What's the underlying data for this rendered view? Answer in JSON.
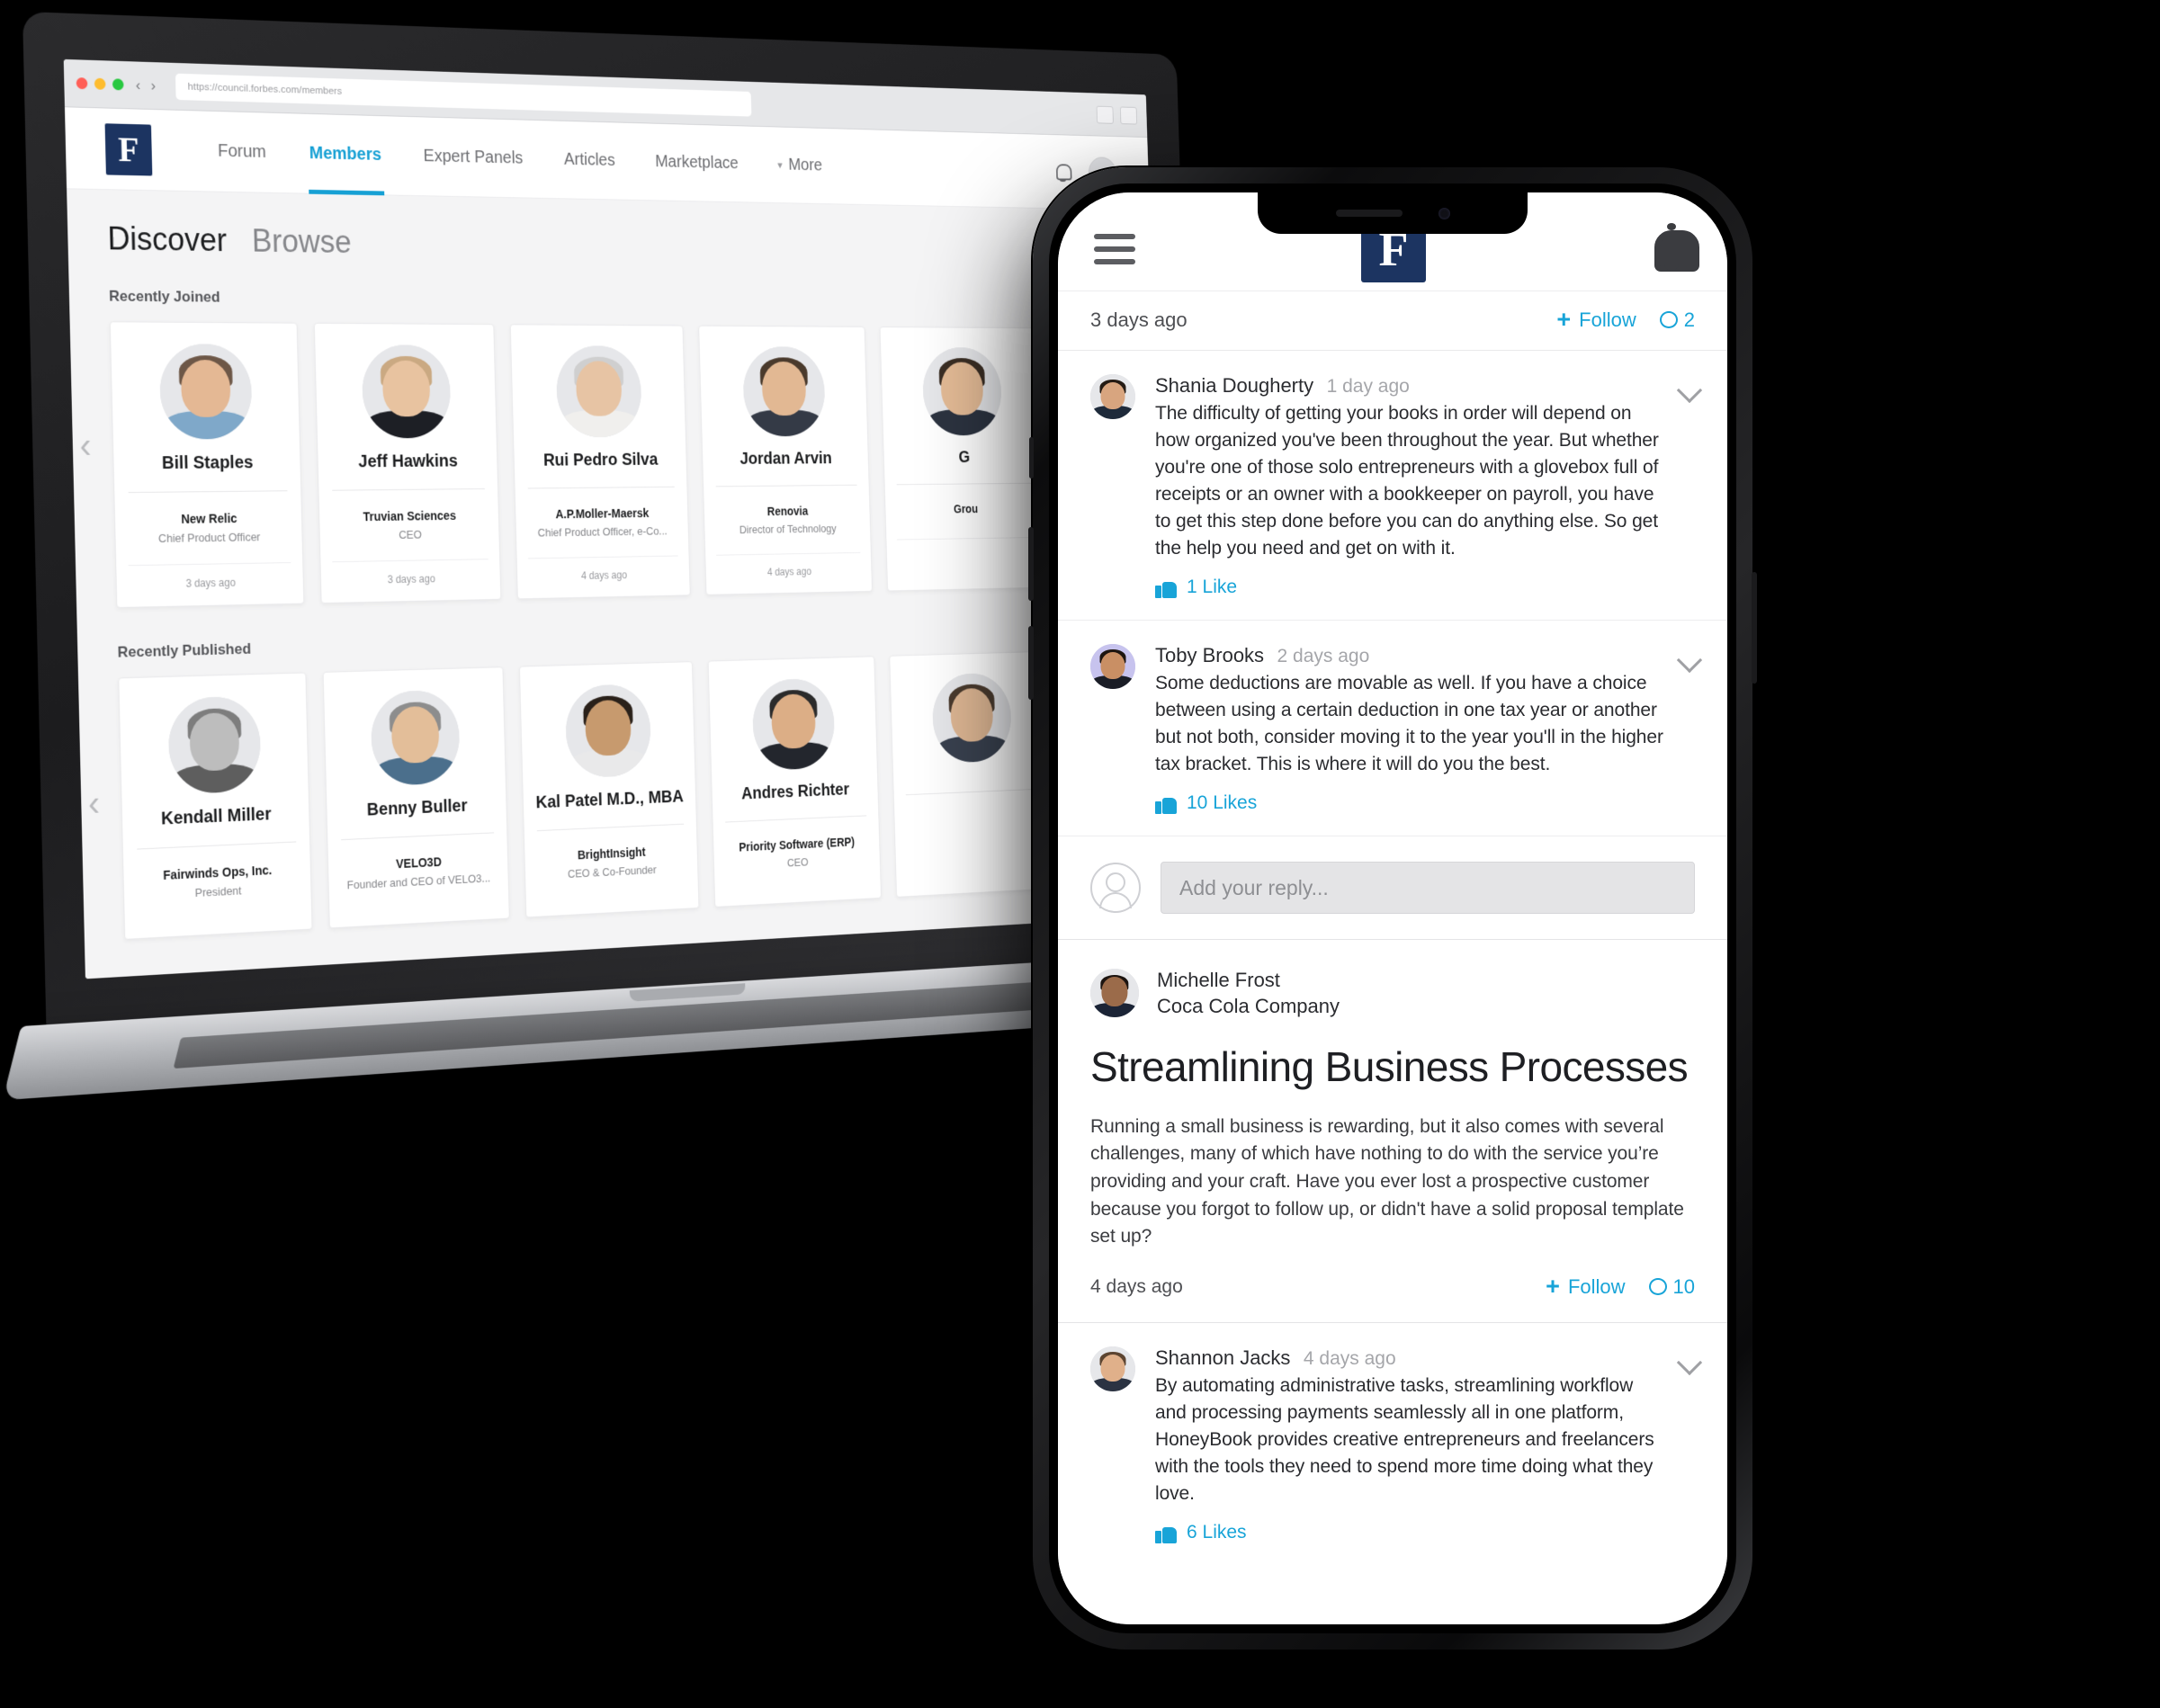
{
  "browser": {
    "url": "https://council.forbes.com/members",
    "traffic_lights": [
      "close",
      "minimize",
      "maximize"
    ],
    "back_label": "‹",
    "forward_label": "›"
  },
  "desktop": {
    "brand_letter": "F",
    "nav": [
      {
        "label": "Forum",
        "active": false,
        "has_chevron": false
      },
      {
        "label": "Members",
        "active": true,
        "has_chevron": false
      },
      {
        "label": "Expert Panels",
        "active": false,
        "has_chevron": false
      },
      {
        "label": "Articles",
        "active": false,
        "has_chevron": false
      },
      {
        "label": "Marketplace",
        "active": false,
        "has_chevron": false
      },
      {
        "label": "More",
        "active": false,
        "has_chevron": true
      }
    ],
    "nav_icons": {
      "notifications": "bell-icon",
      "avatar": "avatar"
    },
    "tabs": [
      {
        "label": "Discover",
        "active": true
      },
      {
        "label": "Browse",
        "active": false
      }
    ],
    "sections": [
      {
        "title": "Recently Joined",
        "prev_arrow": "‹",
        "cards": [
          {
            "name": "Bill Staples",
            "company": "New Relic",
            "role": "Chief Product Officer",
            "joined": "3 days ago",
            "skin": "#e4b894",
            "hair": "#6d5747",
            "shirt": "#7fa8c9"
          },
          {
            "name": "Jeff Hawkins",
            "company": "Truvian Sciences",
            "role": "CEO",
            "joined": "3 days ago",
            "skin": "#e8c3a0",
            "hair": "#caa982",
            "shirt": "#1d1f25"
          },
          {
            "name": "Rui Pedro Silva",
            "company": "A.P.Moller-Maersk",
            "role": "Chief Product Officer, e-Co...",
            "joined": "4 days ago",
            "skin": "#e7c4a4",
            "hair": "#cfcfcf",
            "shirt": "#f0efed"
          },
          {
            "name": "Jordan Arvin",
            "company": "Renovia",
            "role": "Director of Technology",
            "joined": "4 days ago",
            "skin": "#e2b893",
            "hair": "#4a3a2c",
            "shirt": "#343a46"
          },
          {
            "name": "G",
            "company": "Grou",
            "role": "",
            "joined": "",
            "skin": "#e4bb96",
            "hair": "#3a2e24",
            "shirt": "#2c3340"
          }
        ]
      },
      {
        "title": "Recently Published",
        "prev_arrow": "‹",
        "cards": [
          {
            "name": "Kendall Miller",
            "company": "Fairwinds Ops, Inc.",
            "role": "President",
            "joined": "",
            "skin": "#bdbdbd",
            "hair": "#7d7d7d",
            "shirt": "#5e5e5e"
          },
          {
            "name": "Benny Buller",
            "company": "VELO3D",
            "role": "Founder and CEO of VELO3...",
            "joined": "",
            "skin": "#e3be99",
            "hair": "#8d8d8d",
            "shirt": "#4b6f8c"
          },
          {
            "name": "Kal Patel M.D., MBA",
            "company": "BrightInsight",
            "role": "CEO & Co-Founder",
            "joined": "",
            "skin": "#c79a6e",
            "hair": "#2a211a",
            "shirt": "#e9e9ea"
          },
          {
            "name": "Andres Richter",
            "company": "Priority Software (ERP)",
            "role": "CEO",
            "joined": "",
            "skin": "#dcae86",
            "hair": "#2b2b2b",
            "shirt": "#23262d"
          },
          {
            "name": "",
            "company": "",
            "role": "",
            "joined": "",
            "skin": "#ddb693",
            "hair": "#4a3b2e",
            "shirt": "#39414f"
          }
        ]
      }
    ]
  },
  "mobile": {
    "brand_letter": "F",
    "header_icons": {
      "menu": "hamburger-menu-icon",
      "notifications": "bell-icon"
    },
    "top_meta": {
      "ago": "3 days ago",
      "follow_label": "Follow",
      "follow_plus": "+",
      "comment_count": "2"
    },
    "comments_top": [
      {
        "name": "Shania Dougherty",
        "time": "1 day ago",
        "text": "The difficulty of getting your books in order will depend on how organized you've been throughout the year. But whether you're one of those solo entrepreneurs with a glovebox full of receipts or an owner with a bookkeeper on payroll, you have to get this step done before you can do anything else. So get the help you need and get on with it.",
        "likes": "1 Like",
        "skin": "#d8a57f",
        "hair": "#241b14",
        "shirt": "#1e2a3a"
      },
      {
        "name": "Toby Brooks",
        "time": "2 days ago",
        "text": "Some deductions are movable as well. If you have a choice between using a certain deduction in one tax year or another but not both, consider moving it to the year you'll in the higher tax bracket. This is where it will do you the best.",
        "likes": "10 Likes",
        "skin": "#c98f64",
        "hair": "#1d1510",
        "shirt": "#1a1d26",
        "bg": "#c7c3ee"
      }
    ],
    "reply": {
      "placeholder": "Add your reply...",
      "avatar_icon": "user-avatar-icon"
    },
    "post": {
      "author_name": "Michelle Frost",
      "author_company": "Coca Cola Company",
      "title": "Streamlining Business Processes",
      "body": "Running a small business is rewarding, but it also comes with several challenges, many of which have nothing to do with the service you’re providing and your craft. Have you ever lost a prospective customer because you forgot to follow up, or didn't have a solid proposal template set up?",
      "ago": "4 days ago",
      "follow_label": "Follow",
      "follow_plus": "+",
      "comment_count": "10",
      "skin": "#9b6b4a",
      "hair": "#1c1410",
      "shirt": "#1b2436"
    },
    "comments_bottom": [
      {
        "name": "Shannon Jacks",
        "time": "4 days ago",
        "text": "By automating administrative tasks, streamlining workflow and processing payments seamlessly all in one platform, HoneyBook provides creative entrepreneurs and freelancers with the tools they need to spend more time doing what they love.",
        "likes": "6 Likes",
        "skin": "#e0b08a",
        "hair": "#5c4430",
        "shirt": "#2b3342"
      }
    ]
  },
  "colors": {
    "accent": "#18a4d8",
    "brand_navy": "#1c3461",
    "page_bg": "#f4f4f5"
  }
}
